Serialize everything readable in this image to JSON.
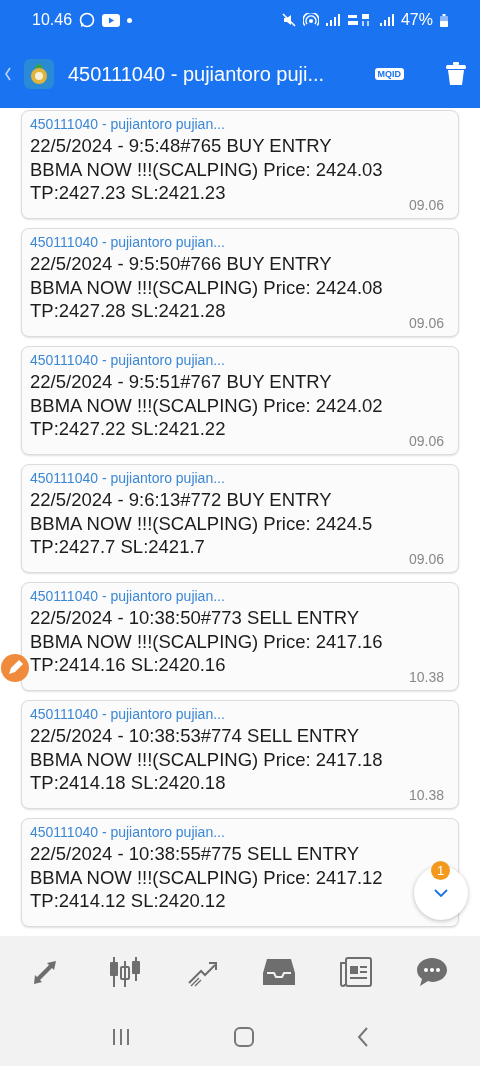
{
  "status_bar": {
    "time": "10.46",
    "battery": "47%"
  },
  "app_bar": {
    "title": "450111040 - pujiantoro puji...",
    "badge": "MQID"
  },
  "messages": [
    {
      "sender": "450111040 - pujiantoro pujian...",
      "text": "22/5/2024 - 9:5:48#765 BUY ENTRY\nBBMA NOW !!!(SCALPING) Price: 2424.03\nTP:2427.23 SL:2421.23",
      "time": "09.06"
    },
    {
      "sender": "450111040 - pujiantoro pujian...",
      "text": "22/5/2024 - 9:5:50#766 BUY ENTRY\nBBMA NOW !!!(SCALPING) Price: 2424.08\nTP:2427.28 SL:2421.28",
      "time": "09.06"
    },
    {
      "sender": "450111040 - pujiantoro pujian...",
      "text": "22/5/2024 - 9:5:51#767 BUY ENTRY\nBBMA NOW !!!(SCALPING) Price: 2424.02\nTP:2427.22 SL:2421.22",
      "time": "09.06"
    },
    {
      "sender": "450111040 - pujiantoro pujian...",
      "text": "22/5/2024 - 9:6:13#772 BUY ENTRY\nBBMA NOW !!!(SCALPING) Price: 2424.5\nTP:2427.7 SL:2421.7",
      "time": "09.06"
    },
    {
      "sender": "450111040 - pujiantoro pujian...",
      "text": "22/5/2024 - 10:38:50#773 SELL ENTRY\nBBMA NOW !!!(SCALPING) Price: 2417.16\nTP:2414.16 SL:2420.16",
      "time": "10.38"
    },
    {
      "sender": "450111040 - pujiantoro pujian...",
      "text": "22/5/2024 - 10:38:53#774 SELL ENTRY\nBBMA NOW !!!(SCALPING) Price: 2417.18\nTP:2414.18 SL:2420.18",
      "time": "10.38"
    },
    {
      "sender": "450111040 - pujiantoro pujian...",
      "text": "22/5/2024 - 10:38:55#775 SELL ENTRY\nBBMA NOW !!!(SCALPING) Price: 2417.12\nTP:2414.12 SL:2420.12"
    }
  ],
  "scroll_button": {
    "badge": "1"
  },
  "bottom_nav": [
    {
      "kind": "trade"
    },
    {
      "kind": "quotes"
    },
    {
      "kind": "chart"
    },
    {
      "kind": "inbox"
    },
    {
      "kind": "news"
    },
    {
      "kind": "chat"
    }
  ]
}
